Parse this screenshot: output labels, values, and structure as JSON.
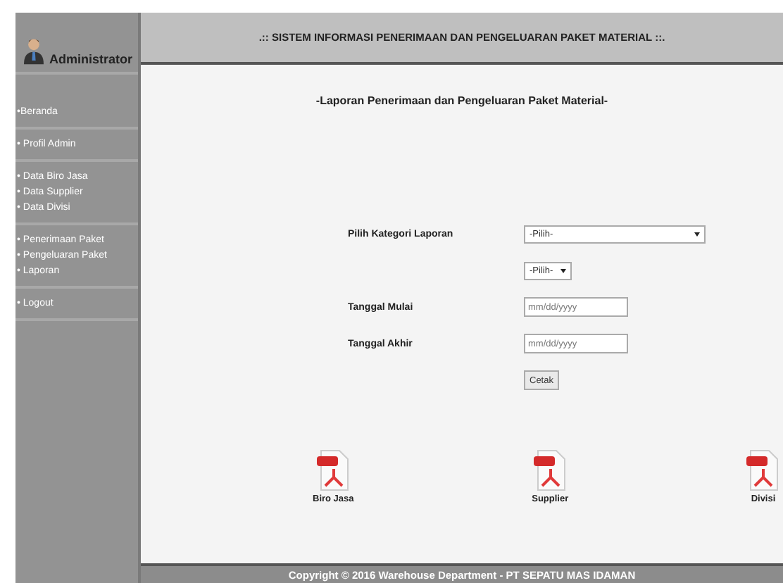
{
  "sidebar": {
    "user": "Administrator",
    "groups": [
      {
        "items": [
          "•Beranda"
        ]
      },
      {
        "items": [
          "• Profil Admin"
        ]
      },
      {
        "items": [
          "• Data Biro Jasa",
          "• Data Supplier",
          "• Data Divisi"
        ]
      },
      {
        "items": [
          "• Penerimaan Paket",
          "• Pengeluaran Paket",
          "• Laporan"
        ]
      },
      {
        "items": [
          "• Logout"
        ]
      }
    ]
  },
  "header": {
    "title": ".:: SISTEM INFORMASI PENERIMAAN DAN PENGELUARAN PAKET MATERIAL ::."
  },
  "content": {
    "heading": "-Laporan Penerimaan dan Pengeluaran Paket Material-",
    "form": [
      {
        "kind": "select",
        "label": "Pilih Kategori Laporan",
        "value": "-Pilih-"
      },
      {
        "kind": "small-select",
        "value": "-Pilih-"
      },
      {
        "kind": "date",
        "label": "Tanggal Mulai",
        "placeholder": "mm/dd/yyyy"
      },
      {
        "kind": "date",
        "label": "Tanggal Akhir",
        "placeholder": "mm/dd/yyyy"
      },
      {
        "kind": "button",
        "value": "Cetak"
      }
    ],
    "downloads": [
      "Biro Jasa",
      "Supplier",
      "Divisi"
    ]
  },
  "footer": "Copyright © 2016 Warehouse Department - PT SEPATU MAS IDAMAN"
}
